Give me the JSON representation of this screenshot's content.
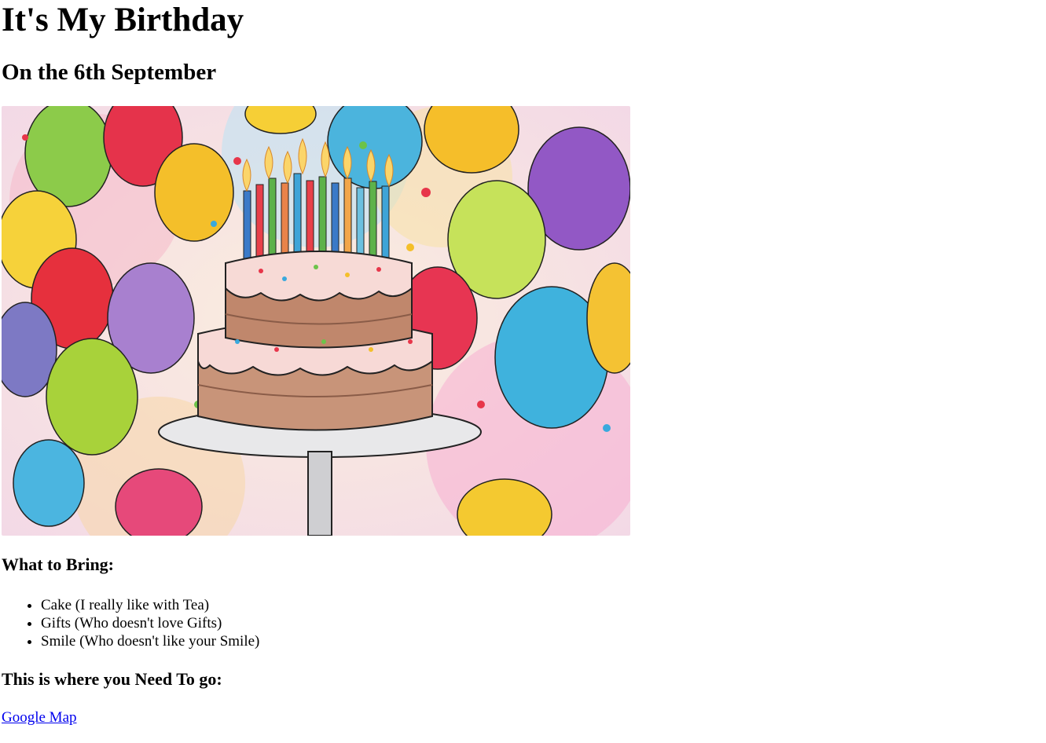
{
  "header": {
    "title": "It's My Birthday",
    "subtitle": "On the 6th September"
  },
  "bring": {
    "heading": "What to Bring:",
    "items": [
      {
        "label": "Cake (I really like with Tea)"
      },
      {
        "label": "Gifts (Who doesn't love Gifts)"
      },
      {
        "label": "Smile (Who doesn't like your Smile)"
      }
    ]
  },
  "directions": {
    "heading": "This is where you Need To go:",
    "link_label": "Google Map"
  },
  "colors": {
    "link": "#0000ee",
    "text": "#000000",
    "background": "#ffffff"
  }
}
